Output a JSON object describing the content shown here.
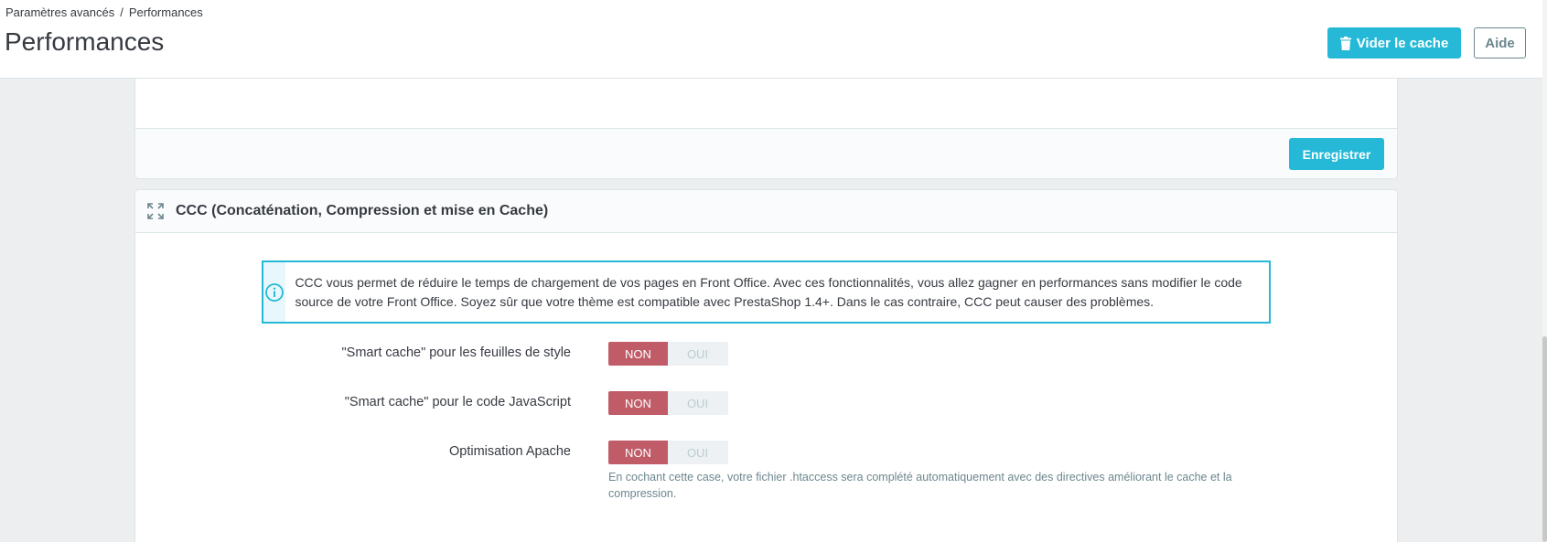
{
  "header": {
    "breadcrumb": [
      "Paramètres avancés",
      "Performances"
    ],
    "breadcrumb_sep": "/",
    "title": "Performances",
    "clear_cache_label": "Vider le cache",
    "help_label": "Aide"
  },
  "top_panel": {
    "save_label": "Enregistrer"
  },
  "ccc_panel": {
    "title": "CCC (Concaténation, Compression et mise en Cache)",
    "alert_text": "CCC vous permet de réduire le temps de chargement de vos pages en Front Office. Avec ces fonctionnalités, vous allez gagner en performances sans modifier le code source de votre Front Office. Soyez sûr que votre thème est compatible avec PrestaShop 1.4+. Dans le cas contraire, CCC peut causer des problèmes.",
    "options": [
      {
        "label": "\"Smart cache\" pour les feuilles de style",
        "off": "NON",
        "on": "OUI",
        "selected": "NON"
      },
      {
        "label": "\"Smart cache\" pour le code JavaScript",
        "off": "NON",
        "on": "OUI",
        "selected": "NON"
      },
      {
        "label": "Optimisation Apache",
        "off": "NON",
        "on": "OUI",
        "selected": "NON"
      }
    ],
    "apache_help": "En cochant cette case, votre fichier .htaccess sera complété automatiquement avec des directives améliorant le cache et la compression."
  },
  "colors": {
    "primary": "#25b9d7",
    "switch_off_active": "#c05c67",
    "text": "#363a41",
    "muted": "#6c868e"
  },
  "icons": {
    "clear_cache": "trash-icon",
    "expand": "expand-icon",
    "alert": "info-circle-icon"
  }
}
